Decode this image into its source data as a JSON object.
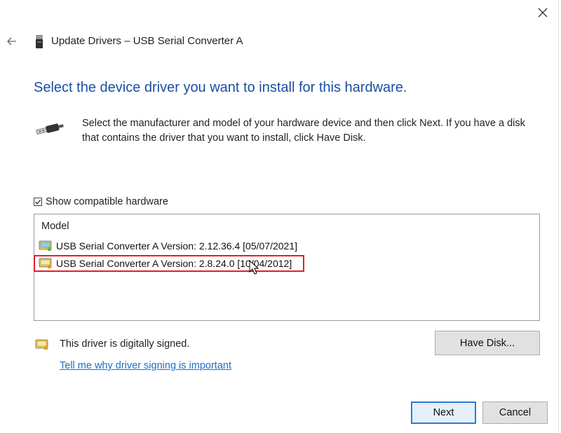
{
  "window": {
    "title": "Update Drivers – USB Serial Converter A",
    "close_icon": "close-icon",
    "back_icon": "back-arrow-icon"
  },
  "heading": "Select the device driver you want to install for this hardware.",
  "description": "Select the manufacturer and model of your hardware device and then click Next. If you have a disk that contains the driver that you want to install, click Have Disk.",
  "show_compatible": {
    "label": "Show compatible hardware",
    "checked": true
  },
  "model_list": {
    "header": "Model",
    "items": [
      {
        "label": "USB Serial Converter A Version: 2.12.36.4 [05/07/2021]",
        "icon": "driver-package-icon"
      },
      {
        "label": "USB Serial Converter A Version: 2.8.24.0 [10/04/2012]",
        "icon": "driver-package-icon",
        "highlighted": true
      }
    ]
  },
  "signing": {
    "status": "This driver is digitally signed.",
    "link": "Tell me why driver signing is important"
  },
  "buttons": {
    "have_disk": "Have Disk...",
    "next": "Next",
    "cancel": "Cancel"
  },
  "colors": {
    "heading": "#1a4fa0",
    "link": "#1a6fc9",
    "highlight_outline": "#e0202a",
    "default_button_border": "#2b7bd9"
  }
}
